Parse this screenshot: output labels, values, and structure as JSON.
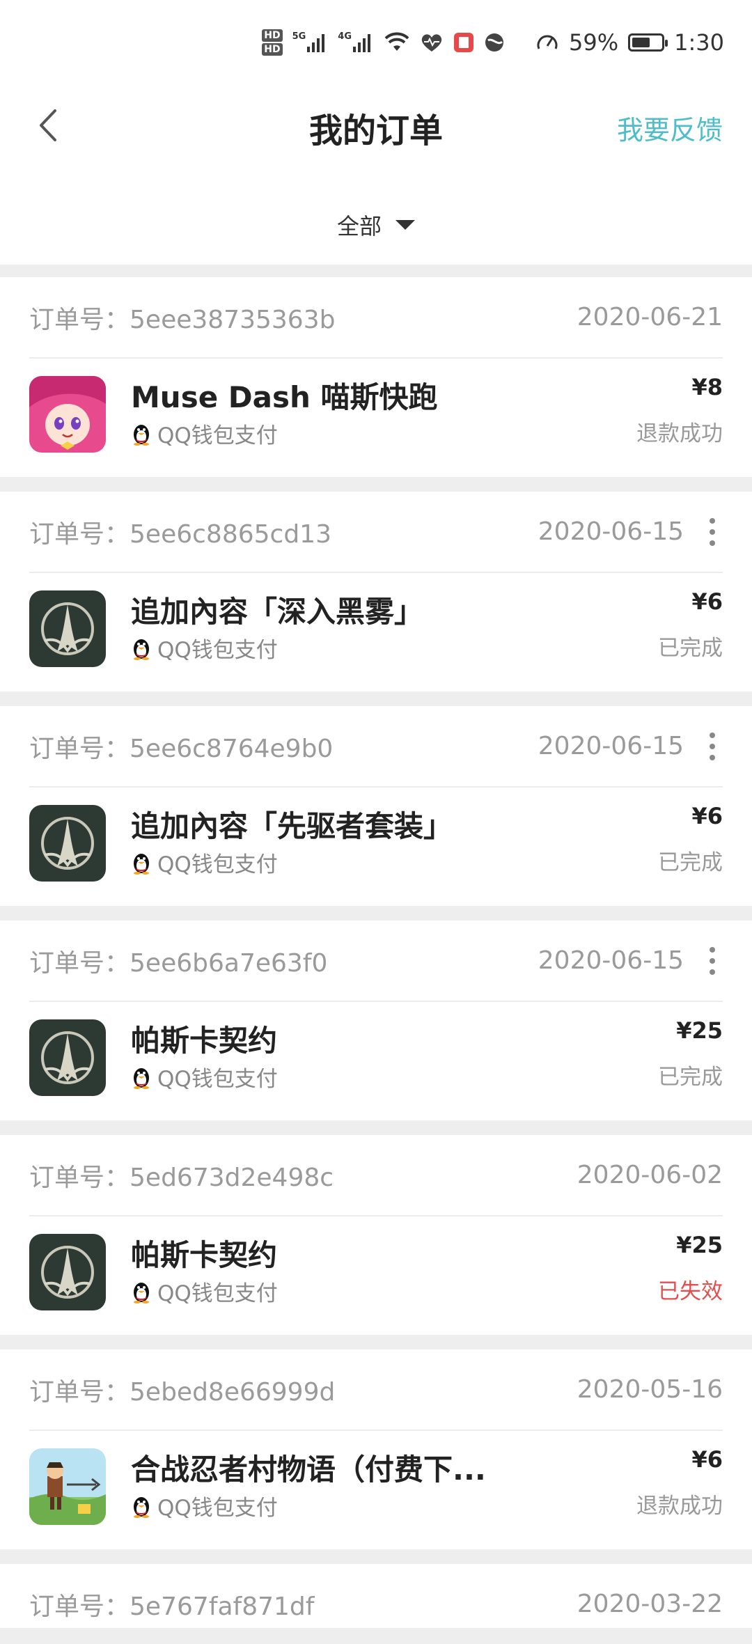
{
  "status_bar": {
    "battery": "59%",
    "time": "1:30",
    "sim1": "HD",
    "sim2": "HD",
    "net1": "5G",
    "net2": "4G"
  },
  "header": {
    "title": "我的订单",
    "feedback": "我要反馈"
  },
  "filter": {
    "label": "全部"
  },
  "order_prefix": "订单号：",
  "orders": [
    {
      "id": "5eee38735363b",
      "date": "2020-06-21",
      "product": "Muse Dash 喵斯快跑",
      "pay": "QQ钱包支付",
      "price": "¥8",
      "status": "退款成功"
    },
    {
      "id": "5ee6c8865cd13",
      "date": "2020-06-15",
      "product": "追加內容「深入黑雾」",
      "pay": "QQ钱包支付",
      "price": "¥6",
      "status": "已完成"
    },
    {
      "id": "5ee6c8764e9b0",
      "date": "2020-06-15",
      "product": "追加內容「先驱者套装」",
      "pay": "QQ钱包支付",
      "price": "¥6",
      "status": "已完成"
    },
    {
      "id": "5ee6b6a7e63f0",
      "date": "2020-06-15",
      "product": "帕斯卡契约",
      "pay": "QQ钱包支付",
      "price": "¥25",
      "status": "已完成"
    },
    {
      "id": "5ed673d2e498c",
      "date": "2020-06-02",
      "product": "帕斯卡契约",
      "pay": "QQ钱包支付",
      "price": "¥25",
      "status": "已失效"
    },
    {
      "id": "5ebed8e66999d",
      "date": "2020-05-16",
      "product": "合战忍者村物语（付费下...",
      "pay": "QQ钱包支付",
      "price": "¥6",
      "status": "退款成功"
    },
    {
      "id": "5e767faf871df",
      "date": "2020-03-22"
    }
  ],
  "colors": {
    "accent": "#4fbdc8",
    "failed": "#e05050"
  }
}
